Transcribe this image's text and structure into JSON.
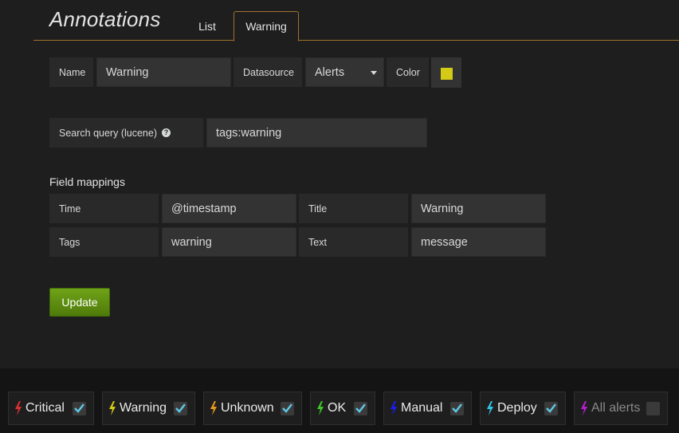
{
  "header": {
    "title": "Annotations",
    "tabs": [
      {
        "label": "List"
      },
      {
        "label": "Warning"
      }
    ]
  },
  "form": {
    "name_label": "Name",
    "name_value": "Warning",
    "datasource_label": "Datasource",
    "datasource_value": "Alerts",
    "color_label": "Color",
    "color_value": "#d5cb17",
    "query_label": "Search query (lucene)",
    "query_help_icon": "?",
    "query_value": "tags:warning",
    "field_mappings_title": "Field mappings",
    "time_label": "Time",
    "time_value": "@timestamp",
    "title_label": "Title",
    "title_value": "Warning",
    "tags_label": "Tags",
    "tags_value": "warning",
    "text_label": "Text",
    "text_value": "message",
    "update_label": "Update"
  },
  "filters": [
    {
      "label": "Critical",
      "color": "#e02f2f",
      "checked": true
    },
    {
      "label": "Warning",
      "color": "#d5cb17",
      "checked": true
    },
    {
      "label": "Unknown",
      "color": "#e89a1a",
      "checked": true
    },
    {
      "label": "OK",
      "color": "#3fc92b",
      "checked": true
    },
    {
      "label": "Manual",
      "color": "#1c1cf0",
      "checked": true
    },
    {
      "label": "Deploy",
      "color": "#2fc6e8",
      "checked": true
    },
    {
      "label": "All alerts",
      "color": "#b51fd1",
      "checked": false
    }
  ],
  "colors": {
    "accent_border": "#a1712a",
    "button_green": "#5e9110",
    "checkmark": "#5fc5e4"
  }
}
